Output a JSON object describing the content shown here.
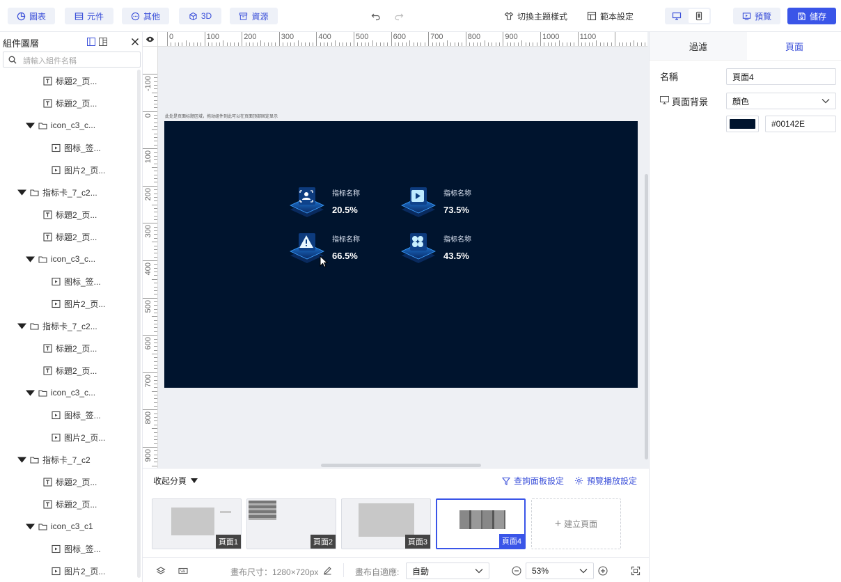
{
  "toolbar": {
    "buttons": [
      "圖表",
      "元件",
      "其他",
      "3D",
      "資源"
    ],
    "theme_switch": "切換主題樣式",
    "template_settings": "範本設定",
    "preview": "預覽",
    "save": "儲存"
  },
  "left_panel": {
    "title": "組件圖層",
    "search_placeholder": "請輸入組件名稱",
    "tree": [
      "标題2_页...",
      "标題2_页...",
      "icon_c3_c...",
      "图标_签...",
      "图片2_页...",
      "指标卡_7_c2...",
      "标題2_页...",
      "标題2_页...",
      "icon_c3_c...",
      "图标_签...",
      "图片2_页...",
      "指标卡_7_c2...",
      "标題2_页...",
      "标題2_页...",
      "icon_c3_c...",
      "图标_签...",
      "图片2_页...",
      "指标卡_7_c2",
      "标題2_页...",
      "标題2_页...",
      "icon_c3_c1",
      "图标_签...",
      "图片2_页..."
    ]
  },
  "ruler": {
    "top": [
      "0",
      "100",
      "200",
      "300",
      "400",
      "500",
      "600",
      "700",
      "800",
      "900",
      "1000",
      "1100"
    ],
    "left": [
      "-100",
      "0",
      "100",
      "200",
      "300",
      "400",
      "500",
      "600",
      "700",
      "800",
      "900"
    ]
  },
  "canvas": {
    "hint": "此处是页面标题区域，拖动组件到此可以在页面顶部固定显示",
    "background": "#00142E",
    "kpis": [
      {
        "label": "指标名称",
        "value": "20.5%",
        "icon": "user-scan-icon"
      },
      {
        "label": "指标名称",
        "value": "73.5%",
        "icon": "play-icon"
      },
      {
        "label": "指标名称",
        "value": "66.5%",
        "icon": "warning-icon"
      },
      {
        "label": "指标名称",
        "value": "43.5%",
        "icon": "grid-icon"
      }
    ]
  },
  "right_panel": {
    "tabs": [
      "過濾",
      "頁面"
    ],
    "name_label": "名稱",
    "name_value": "頁面4",
    "bg_label": "頁面背景",
    "bg_type": "顏色",
    "bg_color": "#00142E"
  },
  "pages": {
    "collapse": "收起分頁",
    "query_panel": "查詢面板設定",
    "playback": "預覽播放設定",
    "items": [
      "頁面1",
      "頁面2",
      "頁面3",
      "頁面4"
    ],
    "add_page": "建立頁面"
  },
  "bottom": {
    "canvas_size_label": "畫布尺寸：1280×720px",
    "adapt_label": "畫布自適應:",
    "adapt_value": "自動",
    "zoom": "53%"
  }
}
